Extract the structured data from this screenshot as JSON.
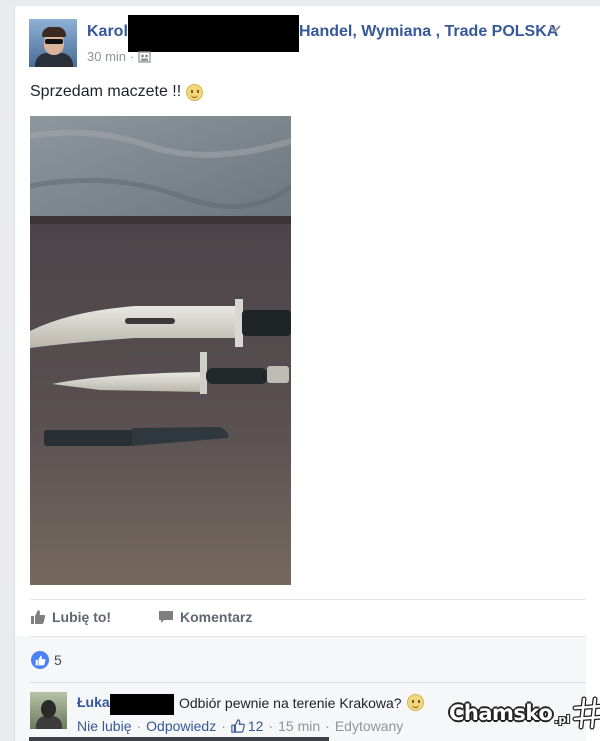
{
  "post": {
    "author_partial": "Karol",
    "group_name_partial": "Handel, Wymiana , Trade POLSKA",
    "time": "30 min",
    "text": "Sprzedam maczete !!"
  },
  "icons": {
    "chevron": "chevron-down-icon",
    "audience": "group-audience-icon",
    "smiley": "smiley-emoji-icon",
    "like": "thumbs-up-icon",
    "comment": "comment-bubble-icon"
  },
  "actions": {
    "like_label": "Lubię to!",
    "comment_label": "Komentarz"
  },
  "reactions": {
    "count": "5"
  },
  "comment": {
    "author_partial": "Łuka",
    "text": "Odbiór pewnie na terenie Krakowa?",
    "unlike_label": "Nie lubię",
    "reply_label": "Odpowiedz",
    "like_count": "12",
    "time": "15 min",
    "edited_label": "Edytowany"
  },
  "watermark": {
    "brand": "Chamsko",
    "suffix": ".pl"
  },
  "colors": {
    "link_blue": "#365899",
    "background": "#e9ebee",
    "like_blue": "#4c82f7",
    "redaction": "#000000"
  }
}
